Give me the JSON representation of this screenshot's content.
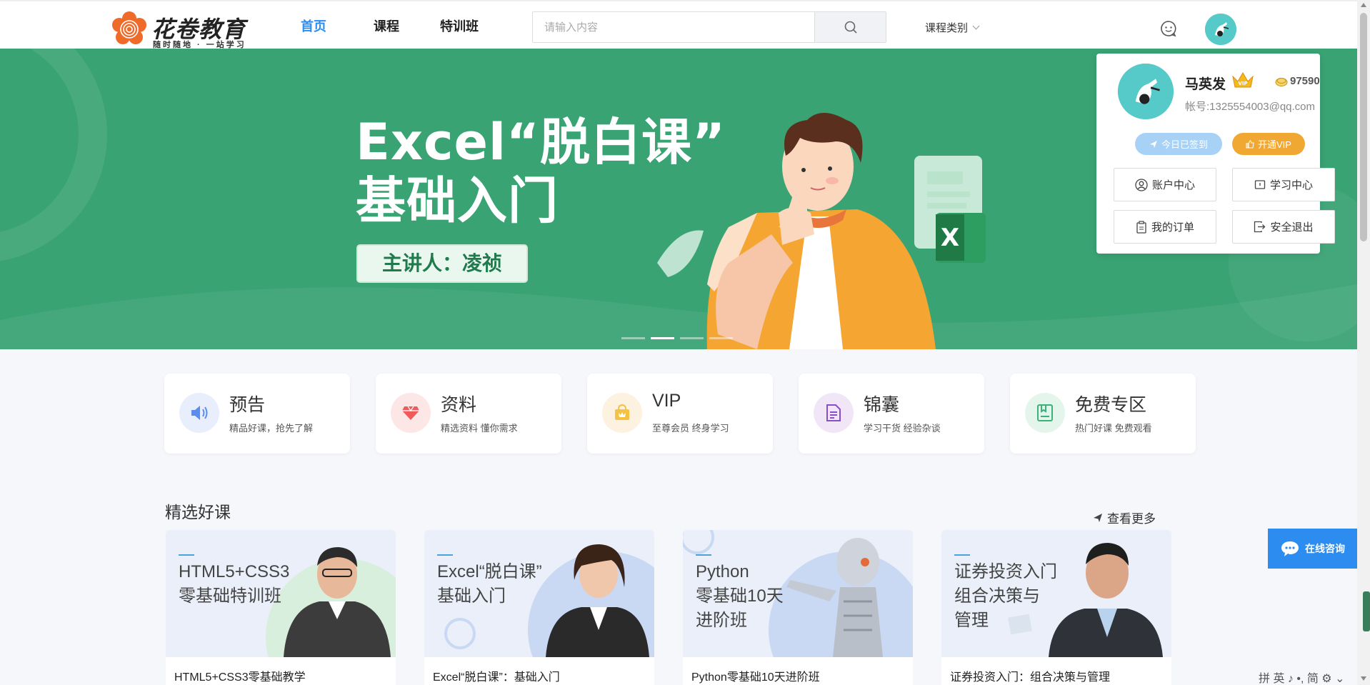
{
  "header": {
    "logo_title": "花卷教育",
    "logo_sub": "随时随地 · 一站学习",
    "nav": [
      "首页",
      "课程",
      "特训班"
    ],
    "search_placeholder": "请输入内容",
    "course_category": "课程类别"
  },
  "banner": {
    "title_line1": "Excel“脱白课”",
    "title_line2": "基础入门",
    "speaker": "主讲人：凌祯",
    "slides": 4,
    "active_slide": 2
  },
  "user": {
    "name": "马英发",
    "coins": "97590",
    "account": "帐号:1325554003@qq.com",
    "signed_label": "今日已签到",
    "vip_label": "开通VIP",
    "menu": [
      "账户中心",
      "学习中心",
      "我的订单",
      "安全退出"
    ]
  },
  "features": [
    {
      "title": "预告",
      "sub": "精品好课，抢先了解",
      "color": "#e8eefc",
      "icon": "speaker-icon"
    },
    {
      "title": "资料",
      "sub": "精选资料 懂你需求",
      "color": "#fde6e6",
      "icon": "gem-icon"
    },
    {
      "title": "VIP",
      "sub": "至尊会员 终身学习",
      "color": "#fdf1df",
      "icon": "vip-bag-icon"
    },
    {
      "title": "锦囊",
      "sub": "学习干货 经验杂谈",
      "color": "#f1e6f8",
      "icon": "document-icon"
    },
    {
      "title": "免费专区",
      "sub": "热门好课 免费观看",
      "color": "#e4f5ec",
      "icon": "book-icon"
    }
  ],
  "section": {
    "title": "精选好课",
    "more": "查看更多"
  },
  "courses": [
    {
      "cover_title": [
        "HTML5+CSS3",
        "零基础特训班"
      ],
      "name": "HTML5+CSS3零基础教学"
    },
    {
      "cover_title": [
        "Excel“脱白课”",
        "基础入门"
      ],
      "name": "Excel“脱白课”：基础入门"
    },
    {
      "cover_title": [
        "Python",
        "零基础10天",
        "进阶班"
      ],
      "name": "Python零基础10天进阶班"
    },
    {
      "cover_title": [
        "证券投资入门",
        "组合决策与",
        "管理"
      ],
      "name": "证券投资入门：组合决策与管理"
    }
  ],
  "consult_label": "在线咨询",
  "ime_text": "拼 英 ♪ •, 简 ⚙ ⌄"
}
